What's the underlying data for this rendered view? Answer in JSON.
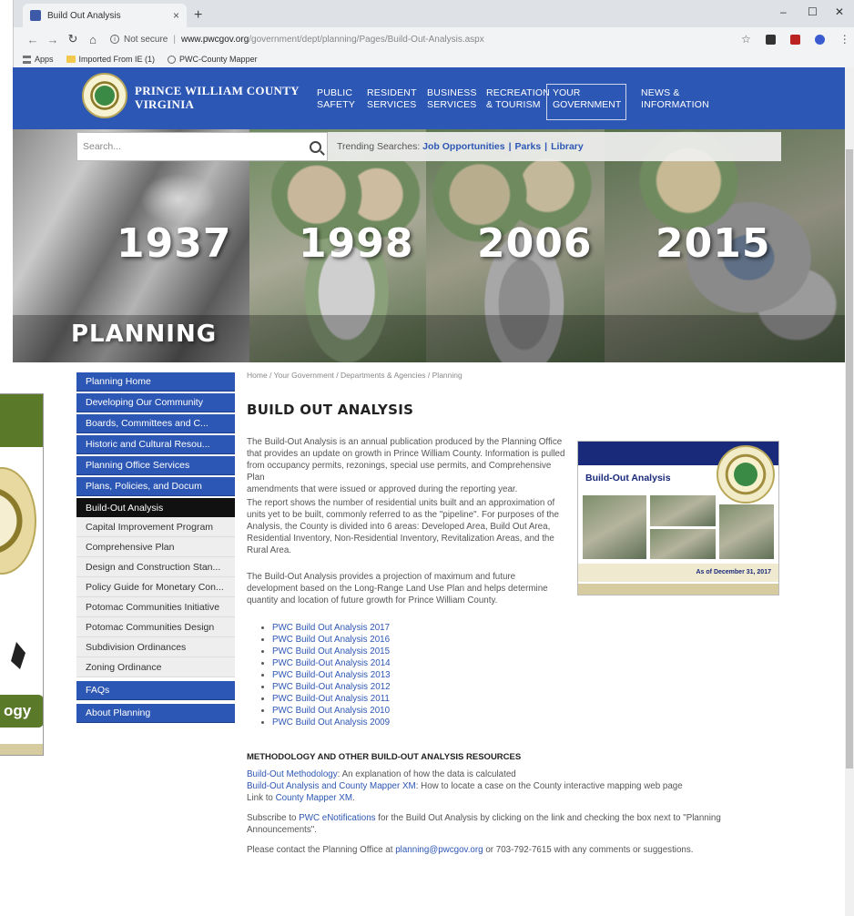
{
  "browser": {
    "tab_title": "Build Out Analysis",
    "tab_close": "×",
    "new_tab": "+",
    "not_secure": "Not secure",
    "url_host": "www.pwcgov.org",
    "url_path": "/government/dept/planning/Pages/Build-Out-Analysis.aspx",
    "bookmarks": [
      "Apps",
      "Imported From IE (1)",
      "PWC-County Mapper"
    ]
  },
  "header": {
    "county_line1": "PRINCE WILLIAM COUNTY",
    "county_line2": "VIRGINIA",
    "nav": [
      {
        "l1": "PUBLIC",
        "l2": "SAFETY"
      },
      {
        "l1": "RESIDENT",
        "l2": "SERVICES"
      },
      {
        "l1": "BUSINESS",
        "l2": "SERVICES"
      },
      {
        "l1": "RECREATION",
        "l2": "& TOURISM"
      },
      {
        "l1": "YOUR",
        "l2": "GOVERNMENT"
      },
      {
        "l1": "NEWS &",
        "l2": "INFORMATION"
      }
    ]
  },
  "search": {
    "placeholder": "Search...",
    "trending_label": "Trending Searches:",
    "trending": [
      "Job Opportunities",
      "Parks",
      "Library"
    ],
    "sep": "|"
  },
  "hero": {
    "years": [
      "1937",
      "1998",
      "2006",
      "2015"
    ],
    "title": "PLANNING"
  },
  "leftnav": [
    "Planning Home",
    "Developing Our Community",
    "Boards, Committees and C...",
    "Historic and Cultural Resou...",
    "Planning Office Services",
    "Plans, Policies, and Docum",
    "Build-Out Analysis",
    "Capital Improvement Program",
    "Comprehensive Plan",
    "Design and Construction Stan...",
    "Policy Guide for Monetary Con...",
    "Potomac Communities Initiative",
    "Potomac Communities Design",
    "Subdivision Ordinances",
    "Zoning Ordinance",
    "FAQs",
    "About Planning"
  ],
  "content": {
    "breadcrumb": "Home / Your Government / Departments & Agencies / Planning",
    "title": "BUILD OUT ANALYSIS",
    "p1": [
      "The Build-Out Analysis is an annual publication produced by the Planning Office",
      "that provides an update on growth in Prince William County. Information is pulled",
      "from occupancy permits, rezonings, special use permits, and Comprehensive Plan",
      "amendments that were issued or approved during the reporting year."
    ],
    "p2": [
      "The report shows the number of residential units built and an approximation of",
      "units yet to be built, commonly referred to as the \"pipeline\". For purposes of the",
      "Analysis, the County is divided into 6 areas: Developed Area, Build Out Area,",
      "Residential Inventory, Non-Residential Inventory, Revitalization Areas, and the",
      "Rural Area."
    ],
    "p3": [
      "The Build-Out Analysis provides a projection of maximum and future",
      "development based on the Long-Range Land Use Plan and helps determine",
      "quantity and location of future growth for Prince William County."
    ],
    "links": [
      "PWC Build Out Analysis 2017",
      "PWC Build Out Analysis 2016",
      "PWC Build Out Analysis 2015",
      "PWC Build-Out Analysis 2014",
      "PWC Build-Out Analysis 2013",
      "PWC Build-Out Analysis 2012",
      "PWC Build-Out Analysis 2011",
      "PWC Build Out Analysis 2010",
      "PWC Build Out Analysis 2009"
    ],
    "subhead": "METHODOLOGY AND OTHER BUILD-OUT ANALYSIS RESOURCES",
    "m1_link": "Build-Out Methodology",
    "m1_text": ": An explanation of how the data is calculated",
    "m2_link": "Build-Out Analysis and County Mapper XM",
    "m2_text": ": How to locate a case on the County interactive mapping web page",
    "m3_text": "Link to ",
    "m3_link": "County Mapper XM",
    "m3_end": ".",
    "sub_text1": "Subscribe to ",
    "sub_link": "PWC eNotifications",
    "sub_text2": " for the Build Out Analysis by clicking on the link and checking the box next to \"Planning",
    "sub_text3": "Announcements\".",
    "contact_text1": "Please contact the Planning Office at ",
    "contact_email": "planning@pwcgov.org",
    "contact_text2": " or 703-792-7615 with any comments or suggestions."
  },
  "report_card": {
    "title": "Build-Out Analysis",
    "date": "As of December 31, 2017"
  },
  "side_card": {
    "pill_text": "ogy"
  }
}
